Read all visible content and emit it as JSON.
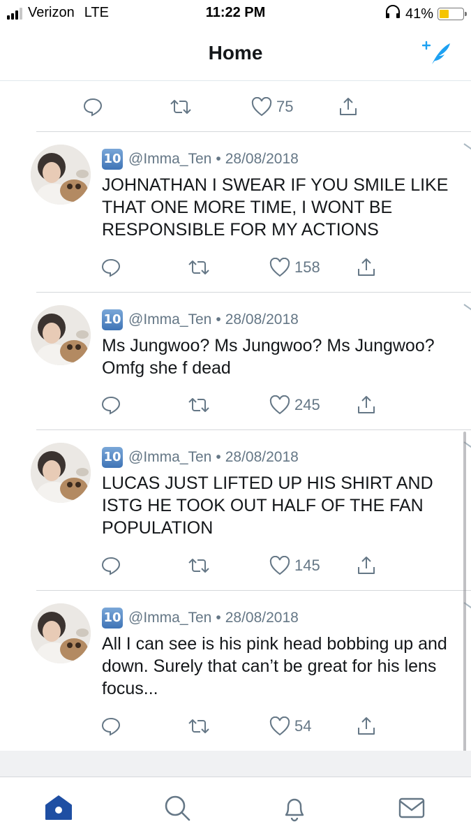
{
  "status_bar": {
    "carrier": "Verizon",
    "network": "LTE",
    "time": "11:22 PM",
    "battery_percent": "41%",
    "battery_level": 0.41,
    "icons": [
      "signal-icon",
      "headphones-icon",
      "battery-icon"
    ]
  },
  "header": {
    "title": "Home",
    "compose_icon": "compose-tweet-icon"
  },
  "colors": {
    "accent": "#1da1f2",
    "text": "#14171a",
    "secondary": "#657786",
    "divider": "#d5d8db",
    "battery_fill": "#f5c400"
  },
  "feed": {
    "top_tweet_actions": {
      "likes": "75"
    },
    "tweets": [
      {
        "handle_emoji": "🔟",
        "handle": "@Imma_Ten",
        "separator": "•",
        "date": "28/08/2018",
        "text": "JOHNATHAN I SWEAR IF YOU SMILE LIKE THAT ONE MORE TIME, I WONT BE RESPONSIBLE  FOR MY ACTIONS",
        "likes": "158"
      },
      {
        "handle_emoji": "🔟",
        "handle": "@Imma_Ten",
        "separator": "•",
        "date": "28/08/2018",
        "text": "Ms Jungwoo? Ms Jungwoo? Ms Jungwoo? Omfg she f dead",
        "likes": "245"
      },
      {
        "handle_emoji": "🔟",
        "handle": "@Imma_Ten",
        "separator": "•",
        "date": "28/08/2018",
        "text": "LUCAS JUST LIFTED UP HIS SHIRT AND ISTG HE TOOK OUT HALF OF THE FAN POPULATION",
        "likes": "145"
      },
      {
        "handle_emoji": "🔟",
        "handle": "@Imma_Ten",
        "separator": "•",
        "date": "28/08/2018",
        "text": "All I can see is his pink head bobbing up and down. Surely that can’t be great for his lens focus...",
        "likes": "54"
      }
    ]
  },
  "tab_bar": {
    "tabs": [
      "home-icon",
      "search-icon",
      "notifications-icon",
      "messages-icon"
    ],
    "active": "home-icon"
  }
}
